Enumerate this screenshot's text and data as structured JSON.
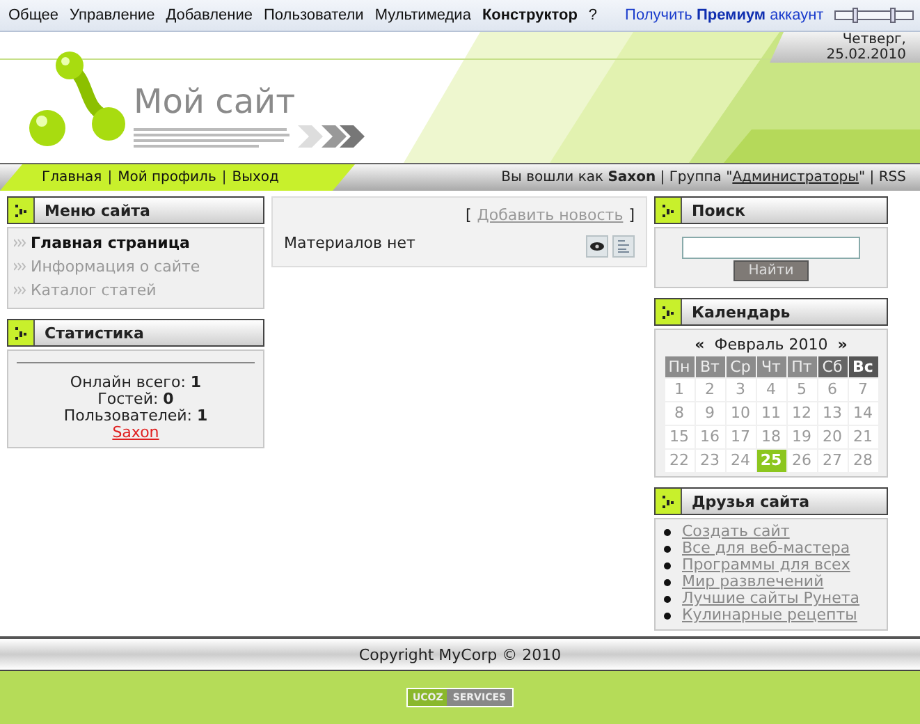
{
  "top_menu": [
    {
      "label": "Общее",
      "selected": false
    },
    {
      "label": "Управление",
      "selected": false
    },
    {
      "label": "Добавление",
      "selected": false
    },
    {
      "label": "Пользователи",
      "selected": false
    },
    {
      "label": "Мультимедиа",
      "selected": false
    },
    {
      "label": "Конструктор",
      "selected": true
    },
    {
      "label": "?",
      "selected": false
    }
  ],
  "premium_link": "Получить **Премиум** аккаунт",
  "site_title": "Мой сайт",
  "date": {
    "weekday": "Четверг,",
    "day": "25.02.2010"
  },
  "nav": {
    "separator": "|",
    "links": [
      "Главная",
      "Мой профиль",
      "Выход"
    ]
  },
  "login": {
    "prefix": "Вы вошли как **Saxon** | Группа \"",
    "group": "Администраторы",
    "suffix": "\" | RSS"
  },
  "site_menu": {
    "title": "Меню сайта",
    "items": [
      {
        "label": "Главная страница",
        "selected": true
      },
      {
        "label": "Информация о сайте",
        "selected": false
      },
      {
        "label": "Каталог статей",
        "selected": false
      }
    ]
  },
  "statistics": {
    "title": "Статистика",
    "lines": [
      "Онлайн всего: **1**",
      "Гостей: **0**",
      "Пользователей: **1**"
    ],
    "user": "Saxon"
  },
  "content": {
    "add_link": "Добавить новость",
    "open": "[",
    "close": "]",
    "empty_text": "Материалов нет"
  },
  "search": {
    "title": "Поиск",
    "button": "Найти"
  },
  "calendar": {
    "title": "Календарь",
    "prev": "«",
    "month": "Февраль 2010",
    "next": "»",
    "weekdays": [
      {
        "label": "Пн",
        "kind": "weekday"
      },
      {
        "label": "Вт",
        "kind": "weekday"
      },
      {
        "label": "Ср",
        "kind": "weekday"
      },
      {
        "label": "Чт",
        "kind": "weekday"
      },
      {
        "label": "Пт",
        "kind": "weekday"
      },
      {
        "label": "Сб",
        "kind": "saturday"
      },
      {
        "label": "Вс",
        "kind": "sunday"
      }
    ],
    "days": [
      {
        "label": "1",
        "selected": false
      },
      {
        "label": "2",
        "selected": false
      },
      {
        "label": "3",
        "selected": false
      },
      {
        "label": "4",
        "selected": false
      },
      {
        "label": "5",
        "selected": false
      },
      {
        "label": "6",
        "selected": false
      },
      {
        "label": "7",
        "selected": false
      },
      {
        "label": "8",
        "selected": false
      },
      {
        "label": "9",
        "selected": false
      },
      {
        "label": "10",
        "selected": false
      },
      {
        "label": "11",
        "selected": false
      },
      {
        "label": "12",
        "selected": false
      },
      {
        "label": "13",
        "selected": false
      },
      {
        "label": "14",
        "selected": false
      },
      {
        "label": "15",
        "selected": false
      },
      {
        "label": "16",
        "selected": false
      },
      {
        "label": "17",
        "selected": false
      },
      {
        "label": "18",
        "selected": false
      },
      {
        "label": "19",
        "selected": false
      },
      {
        "label": "20",
        "selected": false
      },
      {
        "label": "21",
        "selected": false
      },
      {
        "label": "22",
        "selected": false
      },
      {
        "label": "23",
        "selected": false
      },
      {
        "label": "24",
        "selected": false
      },
      {
        "label": "25",
        "selected": true
      },
      {
        "label": "26",
        "selected": false
      },
      {
        "label": "27",
        "selected": false
      },
      {
        "label": "28",
        "selected": false
      }
    ]
  },
  "friends": {
    "title": "Друзья сайта",
    "links": [
      "Создать сайт",
      "Все для веб-мастера",
      "Программы для всех",
      "Мир развлечений",
      "Лучшие сайты Рунета",
      "Кулинарные рецепты"
    ]
  },
  "copyright": "Copyright MyCorp © 2010",
  "badge": {
    "left": "UCOZ",
    "right": "SERVICES"
  }
}
